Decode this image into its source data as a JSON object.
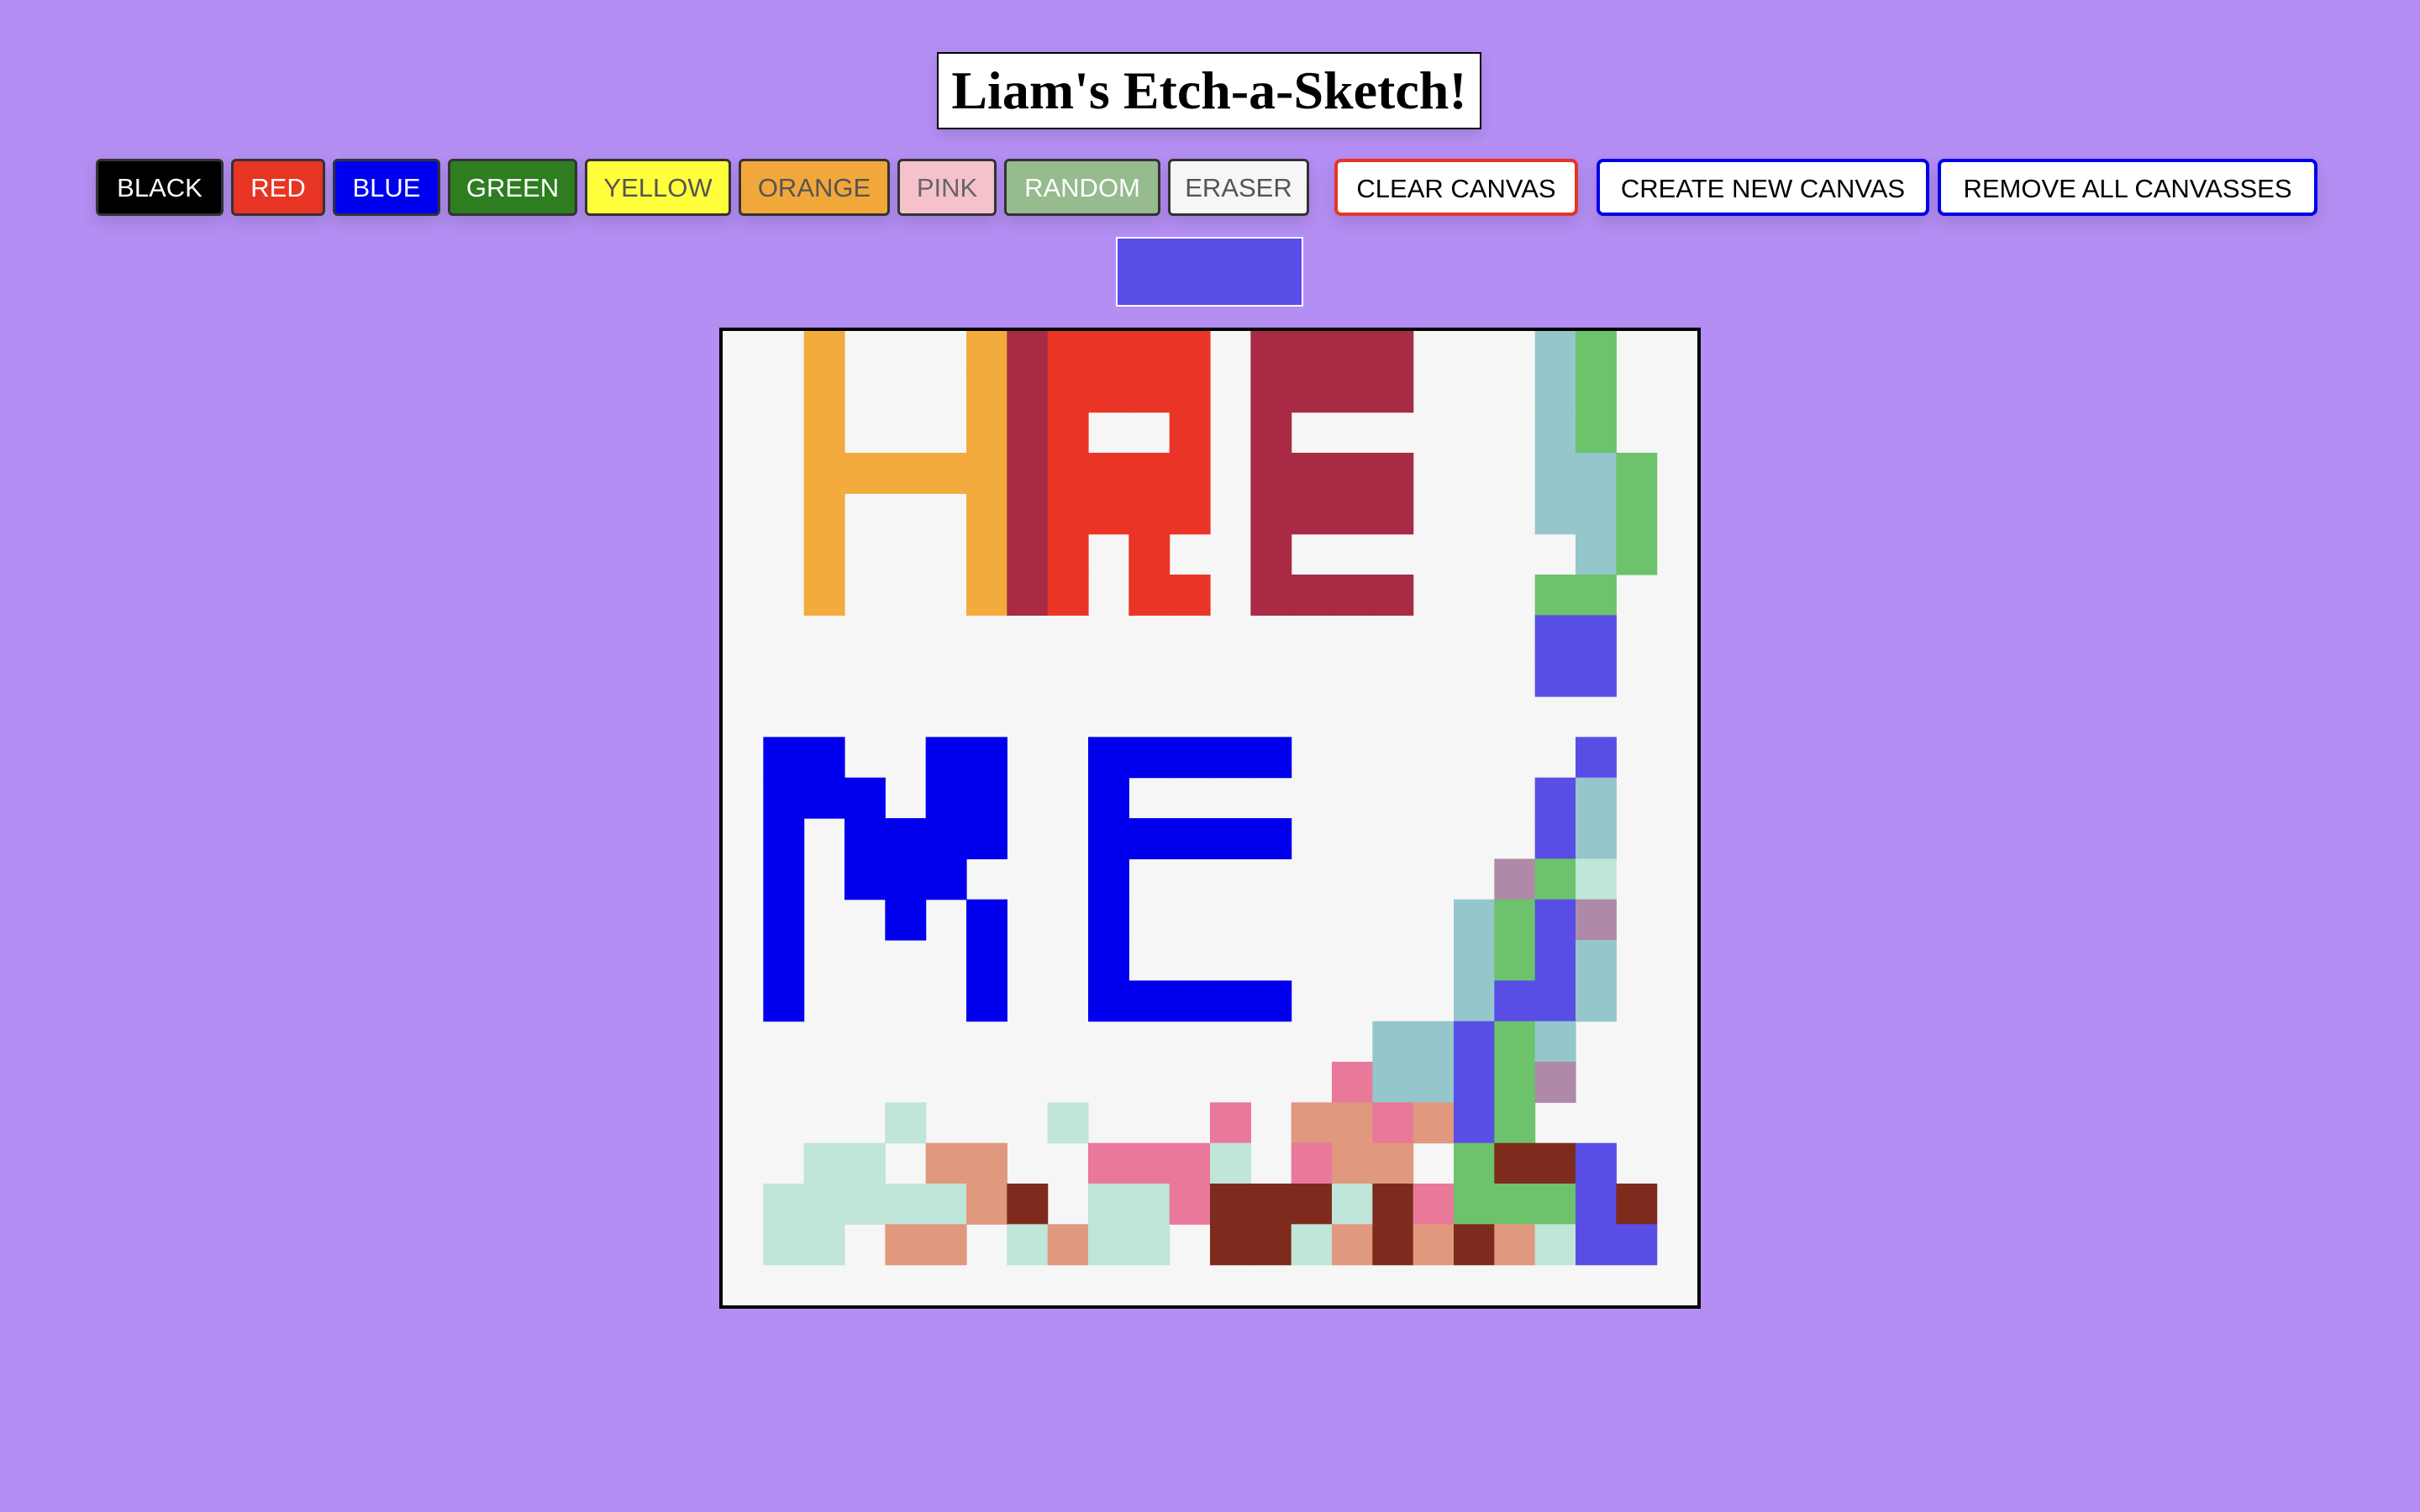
{
  "title": "Liam's Etch-a-Sketch!",
  "color_buttons": [
    {
      "id": "black",
      "label": "BLACK",
      "bg": "#000000",
      "fg": "#ffffff"
    },
    {
      "id": "red",
      "label": "RED",
      "bg": "#e83424",
      "fg": "#ffffff"
    },
    {
      "id": "blue",
      "label": "BLUE",
      "bg": "#0000f0",
      "fg": "#ffffff"
    },
    {
      "id": "green",
      "label": "GREEN",
      "bg": "#2e7d20",
      "fg": "#ffffff"
    },
    {
      "id": "yellow",
      "label": "YELLOW",
      "bg": "#ffff3c",
      "fg": "#555555"
    },
    {
      "id": "orange",
      "label": "ORANGE",
      "bg": "#f2a73a",
      "fg": "#555555"
    },
    {
      "id": "pink",
      "label": "PINK",
      "bg": "#f5c2cb",
      "fg": "#666666"
    },
    {
      "id": "random",
      "label": "RANDOM",
      "bg": "#95bb8f",
      "fg": "#ffffff"
    },
    {
      "id": "eraser",
      "label": "ERASER",
      "bg": "#f6f6f6",
      "fg": "#555555"
    }
  ],
  "action_buttons": [
    {
      "id": "clear-canvas",
      "label": "CLEAR CANVAS",
      "border": "#e83424"
    },
    {
      "id": "create-new-canvas",
      "label": "CREATE NEW CANVAS",
      "border": "#0000e6"
    },
    {
      "id": "remove-all-canvasses",
      "label": "REMOVE ALL CANVASSES",
      "border": "#0000e6"
    }
  ],
  "current_color": "#5a4ee8",
  "canvas": {
    "cols": 24,
    "rows": 24,
    "background": "#f6f6f6",
    "palette": {
      ".": "#f6f6f6",
      "O": "#f2ab3c",
      "M": "#a82a45",
      "R": "#ea3526",
      "T": "#95c6cb",
      "G": "#6cc36c",
      "V": "#584ee6",
      "B": "#0000ef",
      "P": "#e9789b",
      "S": "#e0987f",
      "C": "#c0e5d9",
      "D": "#7e2b1e",
      "L": "#ae8aa8"
    },
    "rows_data": [
      "..O...OMRRRR.MMMM...TG..",
      "..O...OMRRRR.MMMM...TG..",
      "..O...OMR..R.M......TG..",
      "..OOOOOMRRRR.MMMM...TTG.",
      "..O...OMRRRR.MMMM...TTG.",
      "..O...OMR.R..M.......TG.",
      "..O...OMR.RR.MMMM...GG..",
      "....................VV..",
      "....................VV..",
      "........................",
      ".BB..BB..BBBBB.......V..",
      ".BBB.BB..B..........VT..",
      ".B.BBBB..BBBBB......VT..",
      ".B.BBB...B.........LGC..",
      ".B..B.B..B........TGVL..",
      ".B....B..B........TGVT..",
      ".B....B..BBBBB....TVVT..",
      "................TTVGT...",
      "...............PTTVGL...",
      "....C...C...P.SSPSVG....",
      "..CC.SS..PPPC.PSS.GDDV..",
      ".CCCCCSD.CCPDDDCDPGGGVD.",
      ".CC.SS.CSCC.DDCSDSDSCVV."
    ]
  }
}
